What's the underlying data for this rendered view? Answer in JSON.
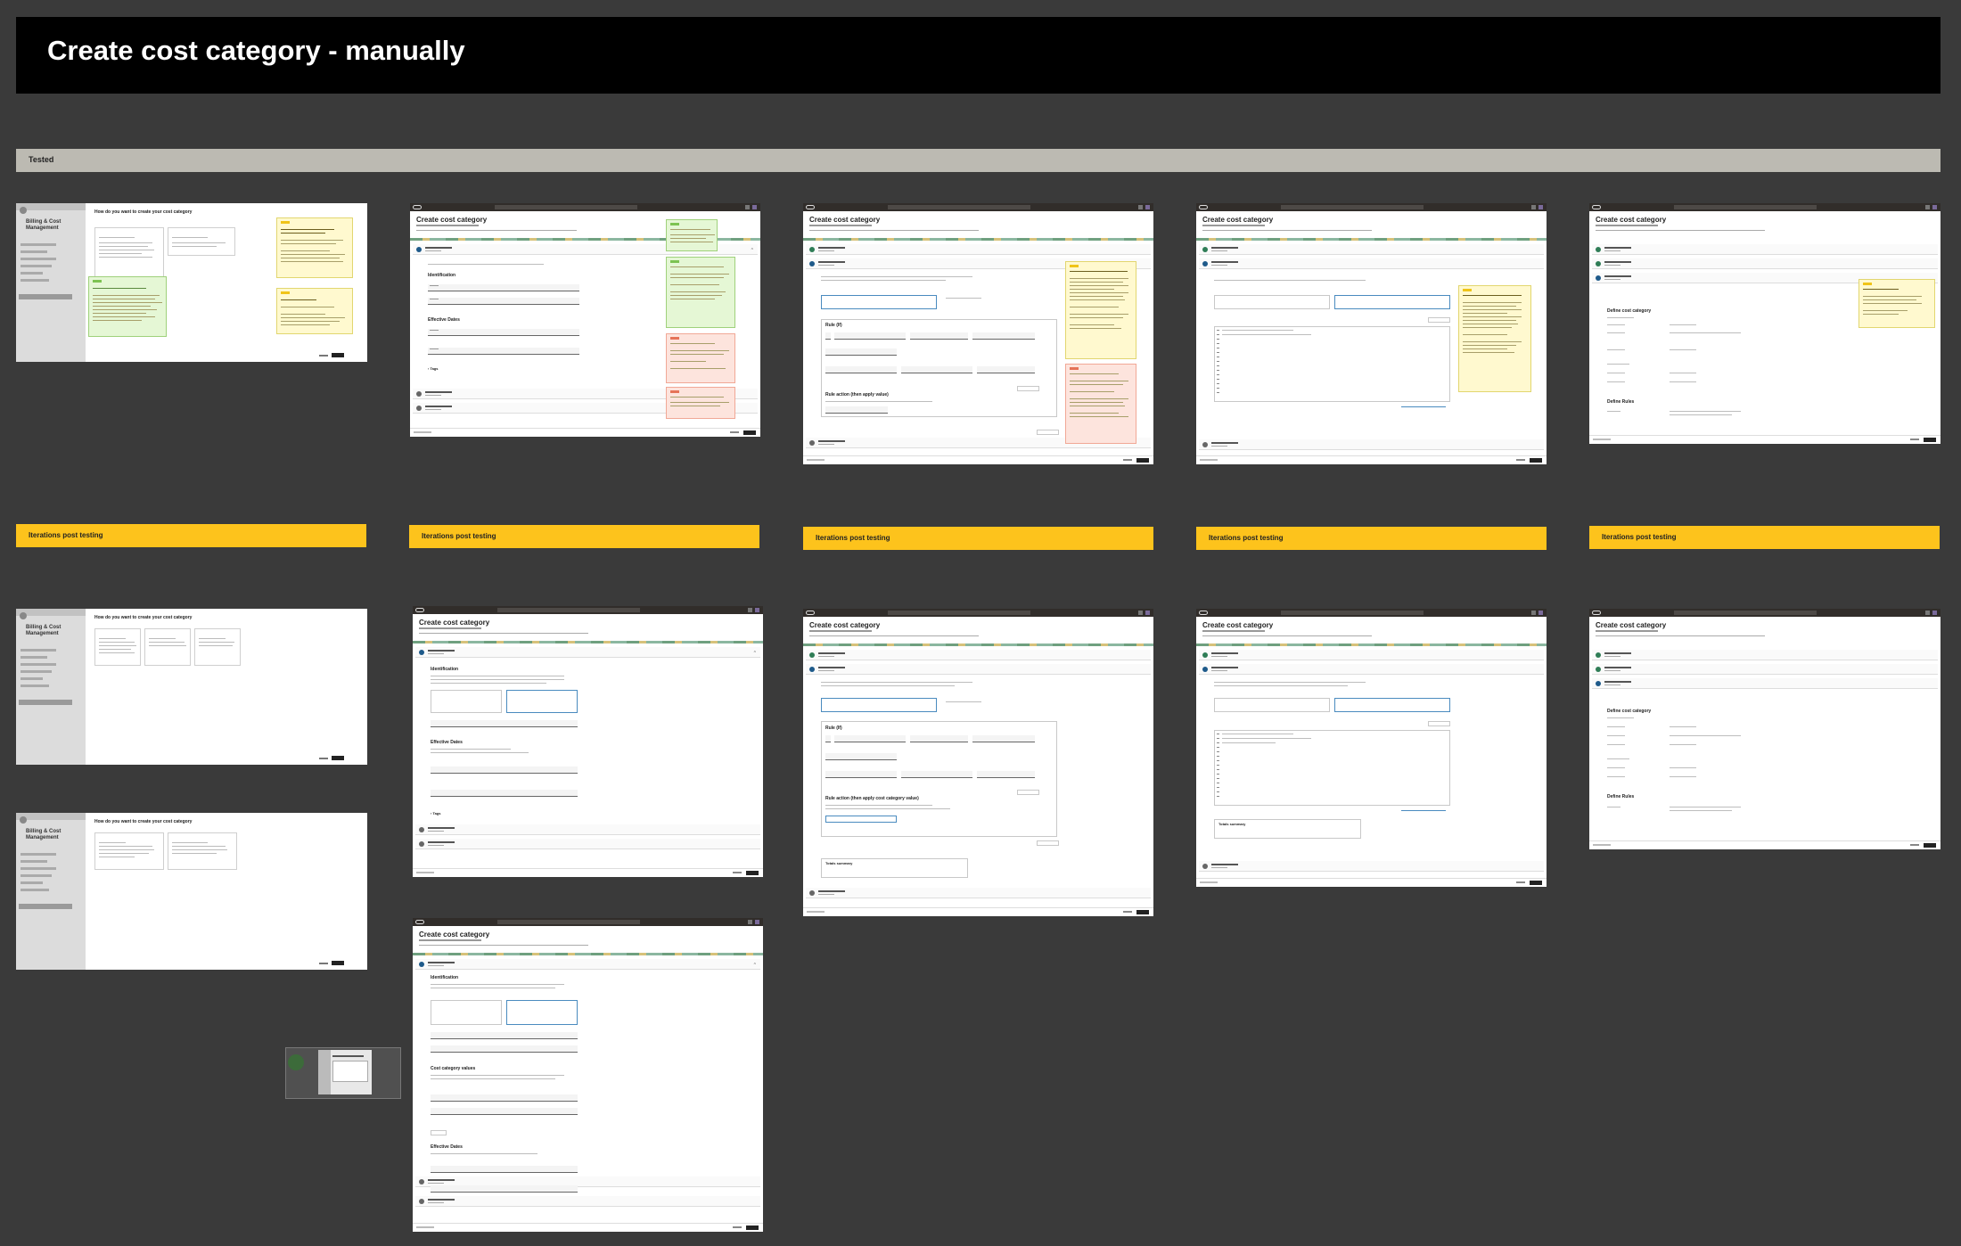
{
  "page": {
    "title": "Create cost category - manually"
  },
  "sections": {
    "tested_label": "Tested",
    "iteration_label": "Iterations  post testing"
  },
  "app": {
    "page_heading": "Create cost category",
    "dialog_heading": "How do you want to create your cost category",
    "sidebar_title": "Billing & Cost Management"
  },
  "colors": {
    "background": "#3a3a3a",
    "banner": "#000000",
    "tested_bar": "#bcbab2",
    "iteration_bar": "#fdc31c",
    "note_yellow": "#fff9cf",
    "note_green": "#e5f7d5",
    "note_red": "#fde4dd"
  }
}
